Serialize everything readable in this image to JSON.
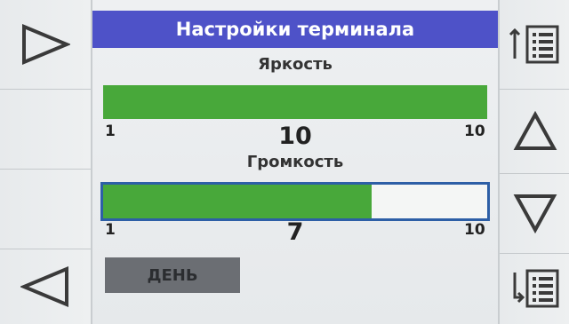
{
  "title": "Настройки терминала",
  "brightness": {
    "label": "Яркость",
    "value": 10,
    "value_text": "10",
    "min_label": "1",
    "max_label": "10",
    "min": 1,
    "max": 10
  },
  "volume": {
    "label": "Громкость",
    "value": 7,
    "value_text": "7",
    "min_label": "1",
    "max_label": "10",
    "min": 1,
    "max": 10
  },
  "mode_button": {
    "label": "ДЕНЬ"
  },
  "nav": {
    "left": [
      "play-right-icon",
      "back-left-icon"
    ],
    "right": [
      "list-up-icon",
      "arrow-up-icon",
      "arrow-down-icon",
      "list-down-icon"
    ]
  },
  "colors": {
    "title_bg": "#4e52c8",
    "bar_fill": "#48a83a",
    "selected_outline": "#2d5fa6",
    "mode_button_bg": "#6b6e73"
  }
}
